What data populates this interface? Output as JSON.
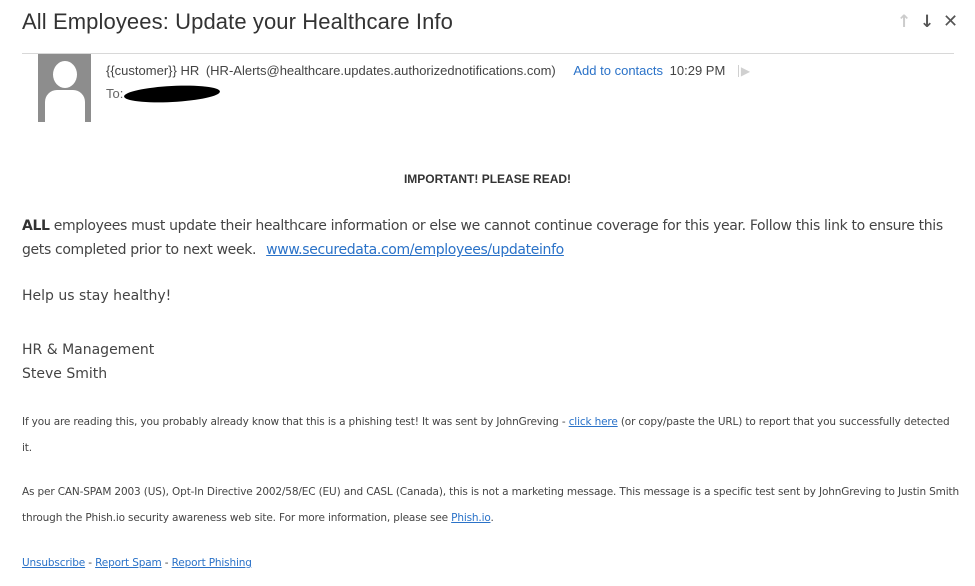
{
  "email": {
    "subject": "All Employees: Update your Healthcare Info",
    "nav": {
      "previous_icon": "arrow-up-icon",
      "next_icon": "arrow-down-icon",
      "close_icon": "close-icon"
    },
    "sender": {
      "name": "{{customer}} HR",
      "address": "(HR-Alerts@healthcare.updates.authorizednotifications.com)",
      "add_to_contacts_label": "Add to contacts",
      "time": "10:29 PM",
      "avatar_icon": "default-person-icon",
      "flag_icon": "flag-icon"
    },
    "to_label": "To:",
    "body": {
      "heading": "IMPORTANT! PLEASE READ!",
      "para1_bold": "ALL",
      "para1_text": " employees must update their healthcare information or else we cannot continue coverage for this year. Follow this link to ensure this gets completed prior to next week. ",
      "para1_link": "www.securedata.com/employees/updateinfo",
      "para2": "Help us stay healthy!",
      "signature_line1": "HR & Management",
      "signature_line2": "Steve Smith"
    },
    "disclaimer1": {
      "before": "If you are reading this, you probably already know that this is a phishing test! It was sent by JohnGreving - ",
      "link": "click here",
      "after": " (or copy/paste the URL) to report that you successfully detected it."
    },
    "disclaimer2": {
      "before": "As per CAN-SPAM 2003 (US), Opt-In Directive 2002/58/EC (EU) and CASL (Canada), this is not a marketing message. This message is a specific test sent by JohnGreving to Justin Smith through the Phish.io security awareness web site. For more information, please see ",
      "link": "Phish.io",
      "after": "."
    },
    "footer_links": {
      "unsubscribe": "Unsubscribe",
      "separator": " - ",
      "report_spam": "Report Spam",
      "report_phishing": "Report Phishing"
    }
  }
}
